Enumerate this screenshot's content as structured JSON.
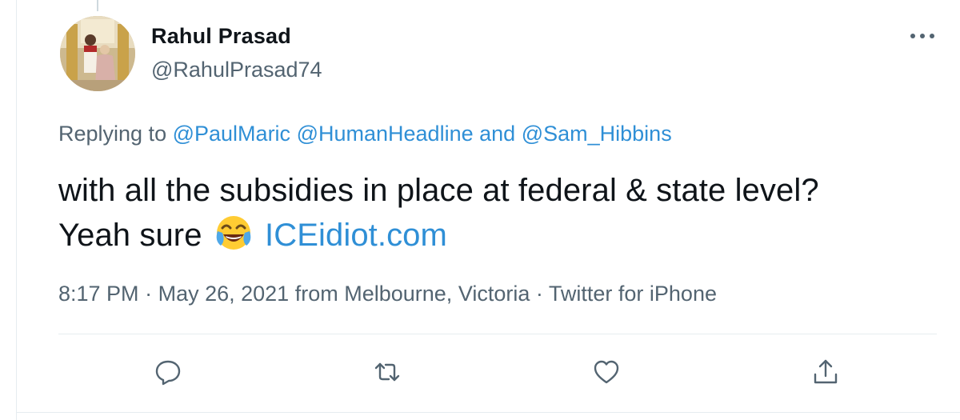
{
  "tweet": {
    "author": {
      "display_name": "Rahul Prasad",
      "handle": "@RahulPrasad74"
    },
    "reply": {
      "prefix": "Replying to",
      "mention_1": "@PaulMaric",
      "mention_2": "@HumanHeadline",
      "conjunction": "and",
      "mention_3": "@Sam_Hibbins"
    },
    "text_line_1": "with all the subsidies in place at federal & state level?",
    "text_line_2_prefix": "Yeah sure",
    "emoji": "face-with-tears-of-joy",
    "link_text": "ICEidiot.com",
    "meta": {
      "time": "8:17 PM",
      "date": "May 26, 2021",
      "location_prefix": "from",
      "location": "Melbourne, Victoria",
      "source": "Twitter for iPhone",
      "separator": "·"
    },
    "actions": [
      "reply-icon",
      "retweet-icon",
      "like-icon",
      "share-icon"
    ],
    "colors": {
      "text": "#0f1419",
      "secondary": "#536471",
      "link": "#2f8fd6",
      "border": "#e6ecf0"
    }
  }
}
